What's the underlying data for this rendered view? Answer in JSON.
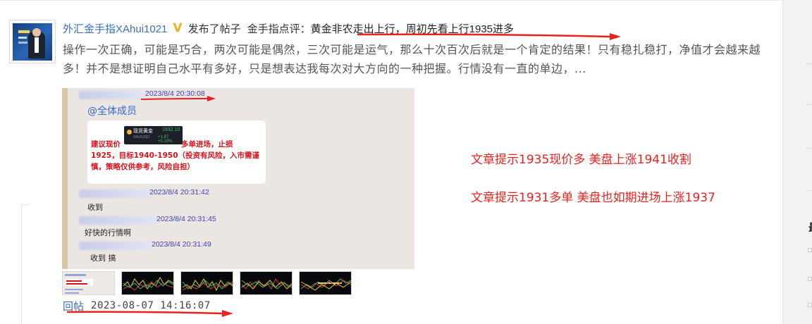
{
  "post": {
    "username": "外汇金手指XAhui1021",
    "verified_mark": "V",
    "action": "发布了帖子",
    "title_prefix": "金手指点评：",
    "title_link": "黄金非农走出上行，周初先看上行1935进多",
    "excerpt": "操作一次正确，可能是巧合，两次可能是偶然，三次可能是运气，那么十次百次后就是一个肯定的结果！只有稳扎稳打，净值才会越来越多！并不是想证明自己水平有多好，只是想表达我每次对大方向的一种把握。行情没有一直的单边，...",
    "reply_label": "回帖",
    "post_time": "2023-08-07 14:16:07",
    "annotation_color": "#e8221f"
  },
  "chat": {
    "mention": "@全体成员",
    "time1": "2023/8/4 20:30:08",
    "bubble_prefix": "建议现价",
    "bubble_suffix": "多单进场，止损",
    "bubble_rest": "1925，目标1940-1950（投资有风险，入市需谨慎，策略仅供参考，风险自担）",
    "ticker_name": "现货黄金",
    "ticker_code": "XAUUSD",
    "ticker_price": "1932.10",
    "ticker_change": "+1.87  +0.10%",
    "time2": "2023/8/4 20:31:42",
    "msg2": "收到",
    "time3": "2023/8/4 20:31:45",
    "msg3": "好快的行情啊",
    "time4": "2023/8/4 20:31:49",
    "msg4": "收到  搞"
  },
  "notes": {
    "line1": "文章提示1935现价多 美盘上涨1941收割",
    "line2": "文章提示1931多单 美盘也如期进场上涨1937"
  },
  "thumbnails": [
    "chat-screenshot",
    "candlestick-chart",
    "candlestick-chart",
    "candlestick-chart",
    "candlestick-chart"
  ],
  "sidebar": {
    "glyph": "最"
  }
}
